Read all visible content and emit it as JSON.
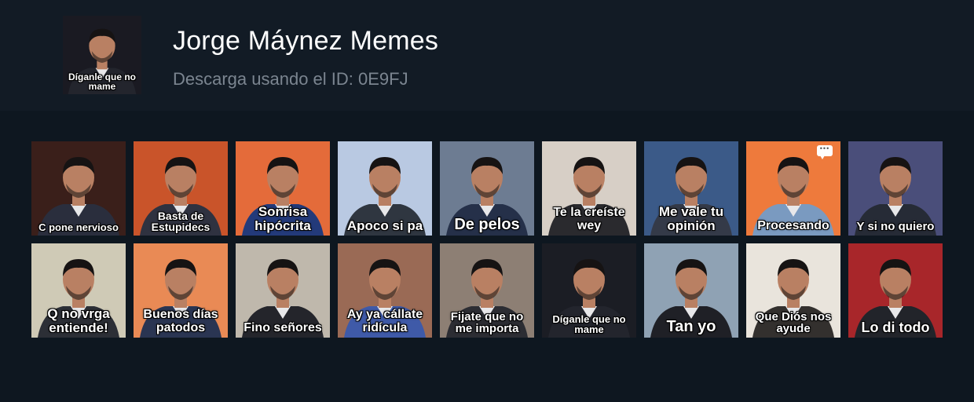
{
  "pack": {
    "title": "Jorge Máynez Memes",
    "subtitle": "Descarga usando el ID: 0E9FJ",
    "thumbnail": {
      "caption": "Díganle que no mame",
      "bg": "#1a1a22",
      "suit": "#23252d"
    }
  },
  "stickers": [
    {
      "caption": "C pone nervioso",
      "bg": "#3a1f1a",
      "suit": "#2a2e3d",
      "size": 13
    },
    {
      "caption": "Basta de Estupidecs",
      "bg": "#c9542a",
      "suit": "#2f3240",
      "size": 14
    },
    {
      "caption": "Sonrisa hipócrita",
      "bg": "#e46b3a",
      "suit": "#233a7a",
      "size": 17
    },
    {
      "caption": "Apoco si pa",
      "bg": "#b9c9e2",
      "suit": "#2f3640",
      "size": 17
    },
    {
      "caption": "De pelos",
      "bg": "#6d7c92",
      "suit": "#253049",
      "size": 20
    },
    {
      "caption": "Te la creíste wey",
      "bg": "#d7cfc6",
      "suit": "#2a2a2e",
      "size": 16
    },
    {
      "caption": "Me vale tu opinión",
      "bg": "#3b5a88",
      "suit": "#343a48",
      "size": 17
    },
    {
      "caption": "Procesando",
      "bg": "#ee7a3c",
      "suit": "#7a9ac0",
      "size": 16,
      "badge": "chat-bubble-icon"
    },
    {
      "caption": "Y si no quiero",
      "bg": "#4a4e7a",
      "suit": "#262b36",
      "size": 15
    },
    {
      "caption": "Q no vrga entiende!",
      "bg": "#cfcab6",
      "suit": "#2c2f36",
      "size": 17
    },
    {
      "caption": "Buenos días patodos",
      "bg": "#e98a55",
      "suit": "#2a3552",
      "size": 16
    },
    {
      "caption": "Fino señores",
      "bg": "#bfb8ac",
      "suit": "#24252b",
      "size": 16
    },
    {
      "caption": "Ay ya cállate ridícula",
      "bg": "#9a6a55",
      "suit": "#3f5aa8",
      "size": 16
    },
    {
      "caption": "Fijate que no me importa",
      "bg": "#8d7f74",
      "suit": "#2c2d33",
      "size": 15
    },
    {
      "caption": "Díganle que no mame",
      "bg": "#1b1d24",
      "suit": "#23252d",
      "size": 13
    },
    {
      "caption": "Tan yo",
      "bg": "#8fa2b4",
      "suit": "#1f2026",
      "size": 20
    },
    {
      "caption": "Que Diós nos ayude",
      "bg": "#e9e4dc",
      "suit": "#33302e",
      "size": 15
    },
    {
      "caption": "Lo di todo",
      "bg": "#a8262a",
      "suit": "#22242a",
      "size": 18
    }
  ],
  "colors": {
    "page_bg": "#0e1720",
    "header_bg": "#121b25",
    "skin": "#b98063",
    "hair": "#161313"
  }
}
